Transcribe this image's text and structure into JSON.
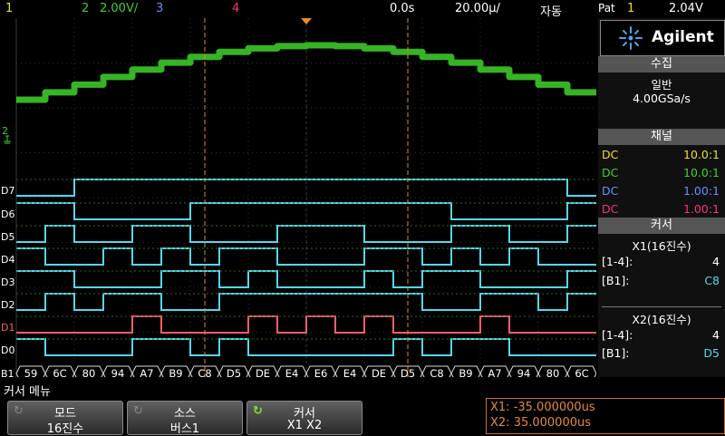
{
  "topbar": {
    "ch1": "1",
    "ch2": "2",
    "ch2_scale": "2.00V/",
    "ch3": "3",
    "ch4": "4",
    "time_offset": "0.0s",
    "time_scale": "20.00µ/",
    "trigger_mode": "자동",
    "pat": "Pat",
    "pat_ch": "1",
    "trigger_level": "2.04V"
  },
  "colors": {
    "analog": "#3fd42a",
    "digital": "#54d8f0",
    "digital_highlight": "#ff6060",
    "cursor": "#e58a3a",
    "ch1": "#f0e020",
    "ch2": "#3fd42a",
    "ch3": "#6a8cff",
    "ch4": "#ff3080"
  },
  "scope": {
    "analog_marker": "2",
    "digital_labels": [
      "D7",
      "D6",
      "D5",
      "D4",
      "D3",
      "D2",
      "D1",
      "D0"
    ],
    "bus_label": "B1",
    "bus_values": [
      "59",
      "6C",
      "80",
      "94",
      "A7",
      "B9",
      "C8",
      "D5",
      "DE",
      "E4",
      "E6",
      "E4",
      "DE",
      "D5",
      "C8",
      "B9",
      "A7",
      "94",
      "80",
      "6C"
    ]
  },
  "side": {
    "brand": "Agilent",
    "acq_title": "수집",
    "acq_mode": "일반",
    "acq_rate": "4.00GSa/s",
    "channels_title": "채널",
    "channels": [
      {
        "coupling": "DC",
        "ratio": "10.0:1",
        "color": "#f0e020"
      },
      {
        "coupling": "DC",
        "ratio": "10.0:1",
        "color": "#3fd42a"
      },
      {
        "coupling": "DC",
        "ratio": "1.00:1",
        "color": "#6a8cff"
      },
      {
        "coupling": "DC",
        "ratio": "1.00:1",
        "color": "#ff3080"
      }
    ],
    "cursor_title": "커서",
    "x1_title": "X1(16진수)",
    "x1_range_label": "[1-4]:",
    "x1_range_val": "4",
    "x1_bus_label": "[B1]:",
    "x1_bus_val": "C8",
    "x2_title": "X2(16진수)",
    "x2_range_label": "[1-4]:",
    "x2_range_val": "4",
    "x2_bus_label": "[B1]:",
    "x2_bus_val": "D5"
  },
  "bottom": {
    "menu_title": "커서 메뉴",
    "mode_label": "모드",
    "mode_value": "16진수",
    "source_label": "소스",
    "source_value": "버스1",
    "cursor_label": "커서",
    "cursor_value": "X1 X2",
    "x1_readout": "X1: -35.000000us",
    "x2_readout": "X2: 35.000000us"
  }
}
